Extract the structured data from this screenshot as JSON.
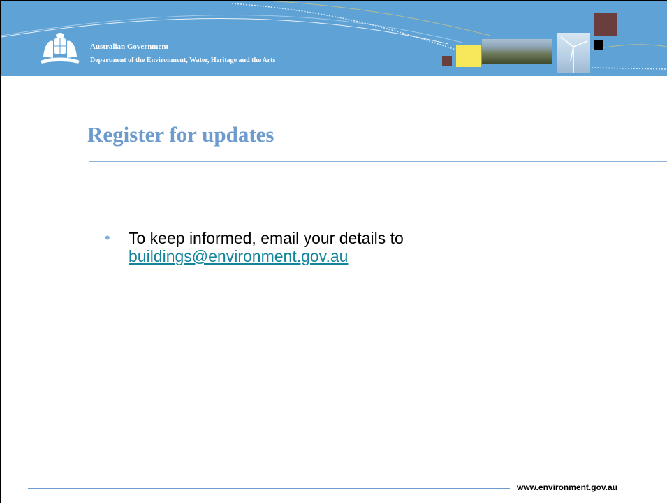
{
  "header": {
    "gov_name": "Australian Government",
    "department": "Department of the Environment, Water, Heritage and the Arts",
    "crest_icon": "coat-of-arms-icon",
    "background_color": "#5ea2d6"
  },
  "main": {
    "title": "Register for updates",
    "title_color": "#6d9bcd",
    "bullets": [
      {
        "text": "To keep informed, email your details to",
        "link": "buildings@environment.gov.au"
      }
    ]
  },
  "footer": {
    "url": "www.environment.gov.au"
  }
}
